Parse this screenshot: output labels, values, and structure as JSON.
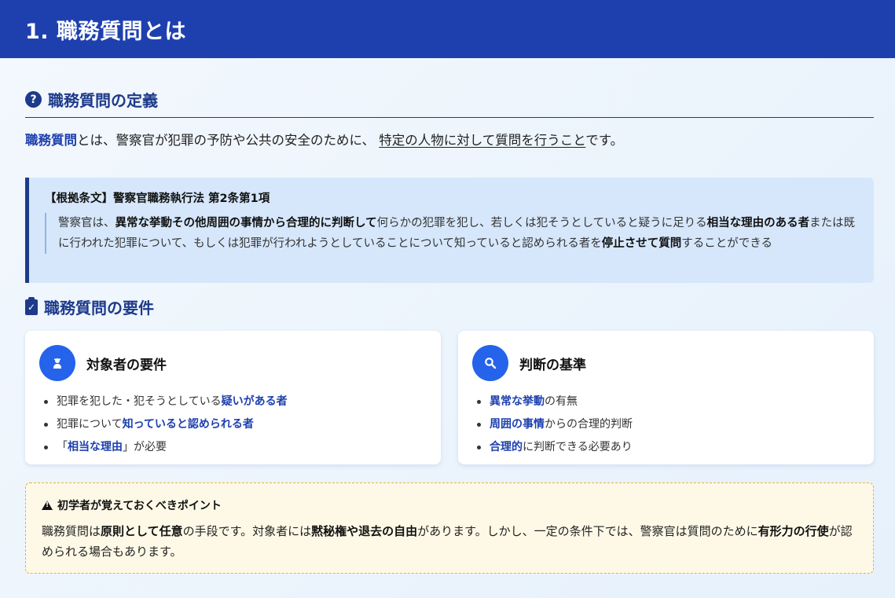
{
  "header": {
    "title": "1. 職務質問とは"
  },
  "definition": {
    "title": "職務質問の定義",
    "icon": "question-circle-icon",
    "term": "職務質問",
    "text_a": "とは、警察官が犯罪の予防や公共の安全のために、",
    "underlined": "特定の人物に対して質問を行うこと",
    "text_b": "です。"
  },
  "law": {
    "title": "【根拠条文】警察官職務執行法 第2条第1項",
    "p1": "警察官は、",
    "b1": "異常な挙動その他周囲の事情から合理的に判断して",
    "p2": "何らかの犯罪を犯し、若しくは犯そうとしていると疑うに足りる",
    "b2": "相当な理由のある者",
    "p3": "または既に行われた犯罪について、もしくは犯罪が行われようとしていることについて知っていると認められる者を",
    "b3": "停止させて質問",
    "p4": "することができる"
  },
  "requirements": {
    "title": "職務質問の要件",
    "icon": "clipboard-check-icon",
    "card_left": {
      "title": "対象者の要件",
      "icon": "user-secret-icon",
      "items": [
        {
          "pre": "犯罪を犯した・犯そうとしている",
          "hl": "疑いがある者",
          "post": ""
        },
        {
          "pre": "犯罪について",
          "hl": "知っていると認められる者",
          "post": ""
        },
        {
          "pre": "「",
          "hl": "相当な理由",
          "post": "」が必要"
        }
      ]
    },
    "card_right": {
      "title": "判断の基準",
      "icon": "search-icon",
      "items": [
        {
          "pre": "",
          "hl": "異常な挙動",
          "post": "の有無"
        },
        {
          "pre": "",
          "hl": "周囲の事情",
          "post": "からの合理的判断"
        },
        {
          "pre": "",
          "hl": "合理的",
          "post": "に判断できる必要あり"
        }
      ]
    }
  },
  "tip": {
    "title": "初学者が覚えておくべきポイント",
    "icon": "warning-icon",
    "p1": "職務質問は",
    "b1": "原則として任意",
    "p2": "の手段です。対象者には",
    "b2": "黙秘権や退去の自由",
    "p3": "があります。しかし、一定の条件下では、警察官は質問のために",
    "b3": "有形力の行使",
    "p4": "が認められる場合もあります。"
  },
  "colors": {
    "header_bg": "#1e40af",
    "accent": "#2563eb",
    "title_text": "#1e3a8a",
    "tip_bg": "#fef9e7"
  }
}
